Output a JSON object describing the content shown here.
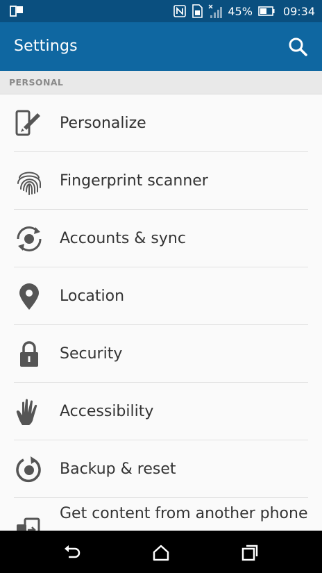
{
  "status_bar": {
    "battery_percent": "45%",
    "time": "09:34",
    "icons": [
      "dual-window-icon",
      "nfc-icon",
      "sim-icon",
      "signal-off-icon",
      "battery-icon"
    ]
  },
  "app_bar": {
    "title": "Settings",
    "search_icon": "search-icon"
  },
  "section": {
    "label": "PERSONAL"
  },
  "items": [
    {
      "label": "Personalize",
      "icon": "personalize-icon"
    },
    {
      "label": "Fingerprint scanner",
      "icon": "fingerprint-icon"
    },
    {
      "label": "Accounts & sync",
      "icon": "sync-icon"
    },
    {
      "label": "Location",
      "icon": "location-pin-icon"
    },
    {
      "label": "Security",
      "icon": "lock-icon"
    },
    {
      "label": "Accessibility",
      "icon": "hand-icon"
    },
    {
      "label": "Backup & reset",
      "icon": "backup-icon"
    },
    {
      "label": "Get content from another phone",
      "icon": "transfer-phone-icon"
    }
  ],
  "nav_bar": {
    "icons": [
      "back-icon",
      "home-icon",
      "recents-icon"
    ]
  },
  "colors": {
    "status_bar": "#0a4f7f",
    "app_bar": "#0f67a1",
    "icon_gray": "#555555"
  }
}
